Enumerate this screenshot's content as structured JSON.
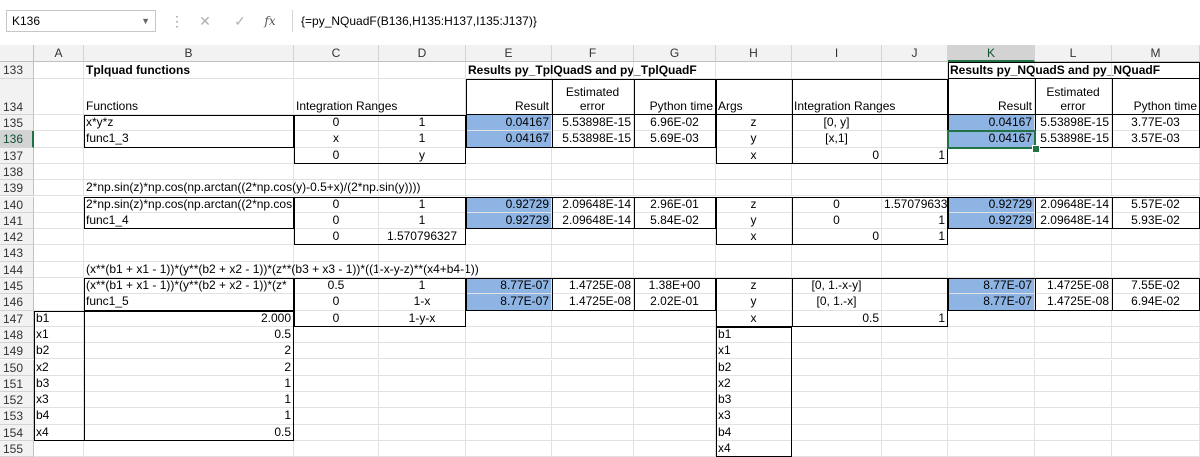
{
  "formula_bar": {
    "name_box": "K136",
    "cancel_icon": "✕",
    "enter_icon": "✓",
    "fx_label": "fx",
    "formula": "{=py_NQuadF(B136,H135:H137,I135:J137)}"
  },
  "columns": [
    "A",
    "B",
    "C",
    "D",
    "E",
    "F",
    "G",
    "H",
    "I",
    "J",
    "K",
    "L",
    "M"
  ],
  "rows": [
    "133",
    "134",
    "135",
    "136",
    "137",
    "138",
    "139",
    "140",
    "141",
    "142",
    "143",
    "144",
    "145",
    "146",
    "147",
    "148",
    "149",
    "150",
    "151",
    "152",
    "153",
    "154",
    "155"
  ],
  "selected": {
    "column": "K",
    "row": "136"
  },
  "cells": {
    "B133": "Tplquad functions",
    "E133": "Results py_TplQuadS and py_TplQuadF",
    "K133": "Results py_NQuadS and py_NQuadF",
    "B134": "Functions",
    "C134": "Integration Ranges",
    "E134": "Result",
    "F134a": "Estimated",
    "F134b": "error",
    "G134": "Python time",
    "H134": "Args",
    "I134": "Integration Ranges",
    "K134": "Result",
    "L134a": "Estimated",
    "L134b": "error",
    "M134": "Python time",
    "B135": "x*y*z",
    "C135": "0",
    "D135": "1",
    "E135": "0.04167",
    "F135": "5.53898E-15",
    "G135": "6.96E-02",
    "H135": "z",
    "I135": "[0, y]",
    "K135": "0.04167",
    "L135": "5.53898E-15",
    "M135": "3.77E-03",
    "B136": "func1_3",
    "C136": "x",
    "D136": "1",
    "E136": "0.04167",
    "F136": "5.53898E-15",
    "G136": "5.69E-03",
    "H136": "y",
    "I136": "[x,1]",
    "K136": "0.04167",
    "L136": "5.53898E-15",
    "M136": "3.57E-03",
    "C137": "0",
    "D137": "y",
    "H137": "x",
    "I137": "0",
    "J137": "1",
    "B139": "2*np.sin(z)*np.cos(np.arctan((2*np.cos(y)-0.5+x)/(2*np.sin(y))))",
    "B140": "2*np.sin(z)*np.cos(np.arctan((2*np.cos",
    "C140": "0",
    "D140": "1",
    "E140": "0.92729",
    "F140": "2.09648E-14",
    "G140": "2.96E-01",
    "H140": "z",
    "I140": "0",
    "J140": "1.57079633",
    "K140": "0.92729",
    "L140": "2.09648E-14",
    "M140": "5.57E-02",
    "B141": "func1_4",
    "C141": "0",
    "D141": "1",
    "E141": "0.92729",
    "F141": "2.09648E-14",
    "G141": "5.84E-02",
    "H141": "y",
    "I141": "0",
    "J141": "1",
    "K141": "0.92729",
    "L141": "2.09648E-14",
    "M141": "5.93E-02",
    "C142": "0",
    "D142": "1.570796327",
    "H142": "x",
    "I142": "0",
    "J142": "1",
    "B144": "(x**(b1 + x1 - 1))*(y**(b2 + x2 - 1))*(z**(b3 + x3 - 1))*((1-x-y-z)**(x4+b4-1))",
    "B145": "(x**(b1 + x1 - 1))*(y**(b2 + x2 - 1))*(z*",
    "C145": "0.5",
    "D145": "1",
    "E145": "8.77E-07",
    "F145": "1.4725E-08",
    "G145": "1.38E+00",
    "H145": "z",
    "I145": "[0, 1.-x-y]",
    "K145": "8.77E-07",
    "L145": "1.4725E-08",
    "M145": "7.55E-02",
    "B146": "func1_5",
    "C146": "0",
    "D146": "1-x",
    "E146": "8.77E-07",
    "F146": "1.4725E-08",
    "G146": "2.02E-01",
    "H146": "y",
    "I146": "[0, 1.-x]",
    "K146": "8.77E-07",
    "L146": "1.4725E-08",
    "M146": "6.94E-02",
    "C147": "0",
    "D147": "1-y-x",
    "H147": "x",
    "I147": "0.5",
    "J147": "1",
    "A147": "b1",
    "B147": "2.000",
    "A148": "x1",
    "B148": "0.5",
    "A149": "b2",
    "B149": "2",
    "A150": "x2",
    "B150": "2",
    "A151": "b3",
    "B151": "1",
    "A152": "x3",
    "B152": "1",
    "A153": "b4",
    "B153": "1",
    "A154": "x4",
    "B154": "0.5",
    "H148": "b1",
    "H149": "x1",
    "H150": "b2",
    "H151": "x2",
    "H152": "b3",
    "H153": "x3",
    "H154": "b4",
    "H155": "x4"
  },
  "colors": {
    "highlight": "#8eb4e3",
    "selection": "#217346"
  }
}
